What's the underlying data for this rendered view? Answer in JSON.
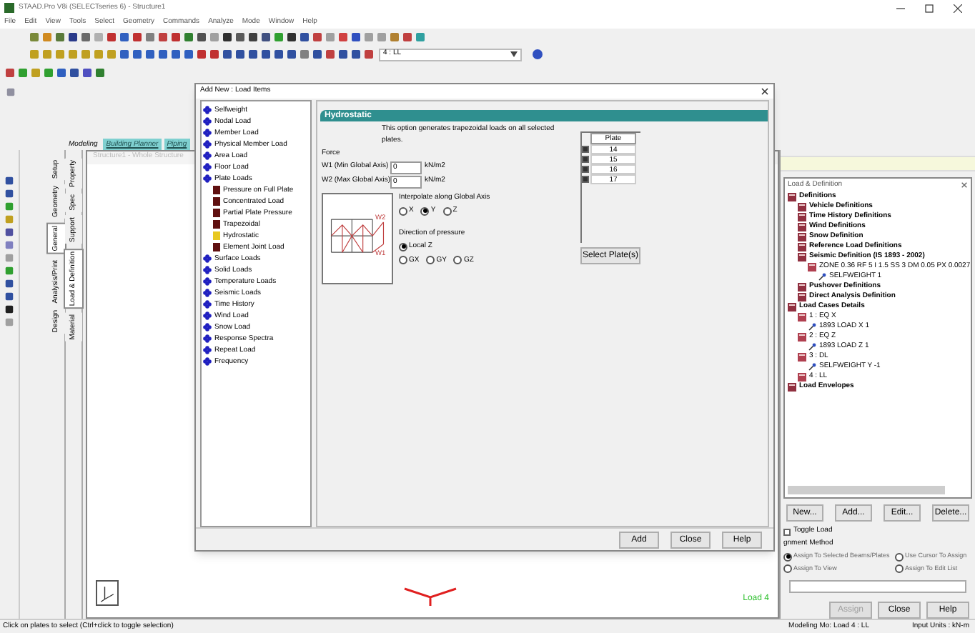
{
  "window": {
    "title": "STAAD.Pro V8i (SELECTseries 6) - Structure1"
  },
  "menu": [
    "File",
    "Edit",
    "View",
    "Tools",
    "Select",
    "Geometry",
    "Commands",
    "Analyze",
    "Mode",
    "Window",
    "Help"
  ],
  "load_selector": {
    "value": "4 : LL"
  },
  "mode_tabs": [
    {
      "label": "Modeling",
      "selected": true
    },
    {
      "label": "Building Planner",
      "selected": false
    },
    {
      "label": "Piping",
      "selected": false
    }
  ],
  "page_tabs": [
    [
      {
        "label": "Setup",
        "selected": false
      },
      {
        "label": "Geometry",
        "selected": false
      },
      {
        "label": "General",
        "selected": true
      },
      {
        "label": "Analysis/Print",
        "selected": false
      },
      {
        "label": "Design",
        "selected": false
      }
    ],
    [
      {
        "label": "Property",
        "selected": false
      },
      {
        "label": "Spec",
        "selected": false
      },
      {
        "label": "Support",
        "selected": false
      },
      {
        "label": "Load & Definition",
        "selected": true
      },
      {
        "label": "Material",
        "selected": false
      }
    ]
  ],
  "viewport": {
    "title": "Structure1 - Whole Structure",
    "load_label": "Load 4"
  },
  "dialog": {
    "title": "Add New : Load Items",
    "items": [
      {
        "label": "Selfweight"
      },
      {
        "label": "Nodal Load"
      },
      {
        "label": "Member Load"
      },
      {
        "label": "Physical Member Load"
      },
      {
        "label": "Area Load"
      },
      {
        "label": "Floor Load"
      },
      {
        "label": "Plate Loads",
        "children": [
          {
            "label": "Pressure on Full Plate",
            "selected": false
          },
          {
            "label": "Concentrated Load",
            "selected": false
          },
          {
            "label": "Partial Plate Pressure",
            "selected": false
          },
          {
            "label": "Trapezoidal",
            "selected": false
          },
          {
            "label": "Hydrostatic",
            "selected": true
          },
          {
            "label": "Element Joint Load",
            "selected": false
          }
        ]
      },
      {
        "label": "Surface Loads"
      },
      {
        "label": "Solid Loads"
      },
      {
        "label": "Temperature Loads"
      },
      {
        "label": "Seismic Loads"
      },
      {
        "label": "Time History"
      },
      {
        "label": "Wind Load"
      },
      {
        "label": "Snow Load"
      },
      {
        "label": "Response Spectra"
      },
      {
        "label": "Repeat Load"
      },
      {
        "label": "Frequency"
      }
    ],
    "header": "Hydrostatic",
    "description": "This option generates trapezoidal loads on all selected plates.",
    "force_label": "Force",
    "fields": [
      {
        "label": "W1 (Min Global Axis)",
        "value": "0",
        "unit": "kN/m2"
      },
      {
        "label": "W2 (Max Global Axis)",
        "value": "0",
        "unit": "kN/m2"
      }
    ],
    "diagram_labels": [
      "W2",
      "W1"
    ],
    "interpolate": {
      "label": "Interpolate along Global Axis",
      "options": [
        {
          "label": "X",
          "selected": false
        },
        {
          "label": "Y",
          "selected": true
        },
        {
          "label": "Z",
          "selected": false
        }
      ]
    },
    "direction": {
      "label": "Direction of pressure",
      "options": [
        {
          "label": "Local Z",
          "selected": true
        },
        {
          "label": "GX",
          "selected": false
        },
        {
          "label": "GY",
          "selected": false
        },
        {
          "label": "GZ",
          "selected": false
        }
      ]
    },
    "plate_table": {
      "column": "Plate",
      "rows": [
        {
          "plate": "14",
          "checked": true
        },
        {
          "plate": "15",
          "checked": true
        },
        {
          "plate": "16",
          "checked": true
        },
        {
          "plate": "17",
          "checked": true
        }
      ]
    },
    "select_button": "Select Plate(s)",
    "buttons": [
      "Add",
      "Close",
      "Help"
    ]
  },
  "load_panel": {
    "title": "Load & Definition",
    "tree": [
      {
        "label": "Definitions",
        "kind": "definition",
        "children": [
          {
            "label": "Vehicle Definitions",
            "kind": "definition"
          },
          {
            "label": "Time History Definitions",
            "kind": "definition"
          },
          {
            "label": "Wind Definitions",
            "kind": "definition"
          },
          {
            "label": "Snow Definition",
            "kind": "definition"
          },
          {
            "label": "Reference Load Definitions",
            "kind": "definition"
          },
          {
            "label": "Seismic Definition (IS 1893 - 2002)",
            "kind": "definition",
            "children": [
              {
                "label": "ZONE 0.36 RF 5 I 1.5 SS 3 DM 0.05 PX 0.0027",
                "kind": "case",
                "children": [
                  {
                    "label": "SELFWEIGHT 1",
                    "kind": "load"
                  }
                ]
              }
            ]
          },
          {
            "label": "Pushover Definitions",
            "kind": "definition"
          },
          {
            "label": "Direct Analysis Definition",
            "kind": "definition"
          }
        ]
      },
      {
        "label": "Load Cases Details",
        "kind": "definition",
        "children": [
          {
            "label": "1 : EQ X",
            "kind": "case",
            "children": [
              {
                "label": "1893 LOAD X 1",
                "kind": "load"
              }
            ]
          },
          {
            "label": "2 : EQ Z",
            "kind": "case",
            "children": [
              {
                "label": "1893 LOAD Z 1",
                "kind": "load"
              }
            ]
          },
          {
            "label": "3 : DL",
            "kind": "case",
            "children": [
              {
                "label": "SELFWEIGHT Y -1",
                "kind": "load"
              }
            ]
          },
          {
            "label": "4 : LL",
            "kind": "case"
          }
        ]
      },
      {
        "label": "Load Envelopes",
        "kind": "definition"
      }
    ],
    "tree_buttons": [
      "New...",
      "Add...",
      "Edit...",
      "Delete..."
    ],
    "toggle_load": {
      "label": "Toggle Load",
      "checked": false
    },
    "method_label": "gnment Method",
    "methods": [
      {
        "label": "Assign To Selected Beams/Plates",
        "selected": true
      },
      {
        "label": "Use Cursor To Assign",
        "selected": false
      },
      {
        "label": "Assign To View",
        "selected": false
      },
      {
        "label": "Assign To Edit List",
        "selected": false
      }
    ],
    "buttons": [
      {
        "label": "Assign",
        "disabled": true
      },
      {
        "label": "Close",
        "disabled": false
      },
      {
        "label": "Help",
        "disabled": false
      }
    ]
  },
  "status_bar": {
    "hint": "Click on plates to select (Ctrl+click to toggle selection)",
    "mode": "Modeling Mo: Load 4 : LL",
    "units": "Input Units : kN-m"
  }
}
